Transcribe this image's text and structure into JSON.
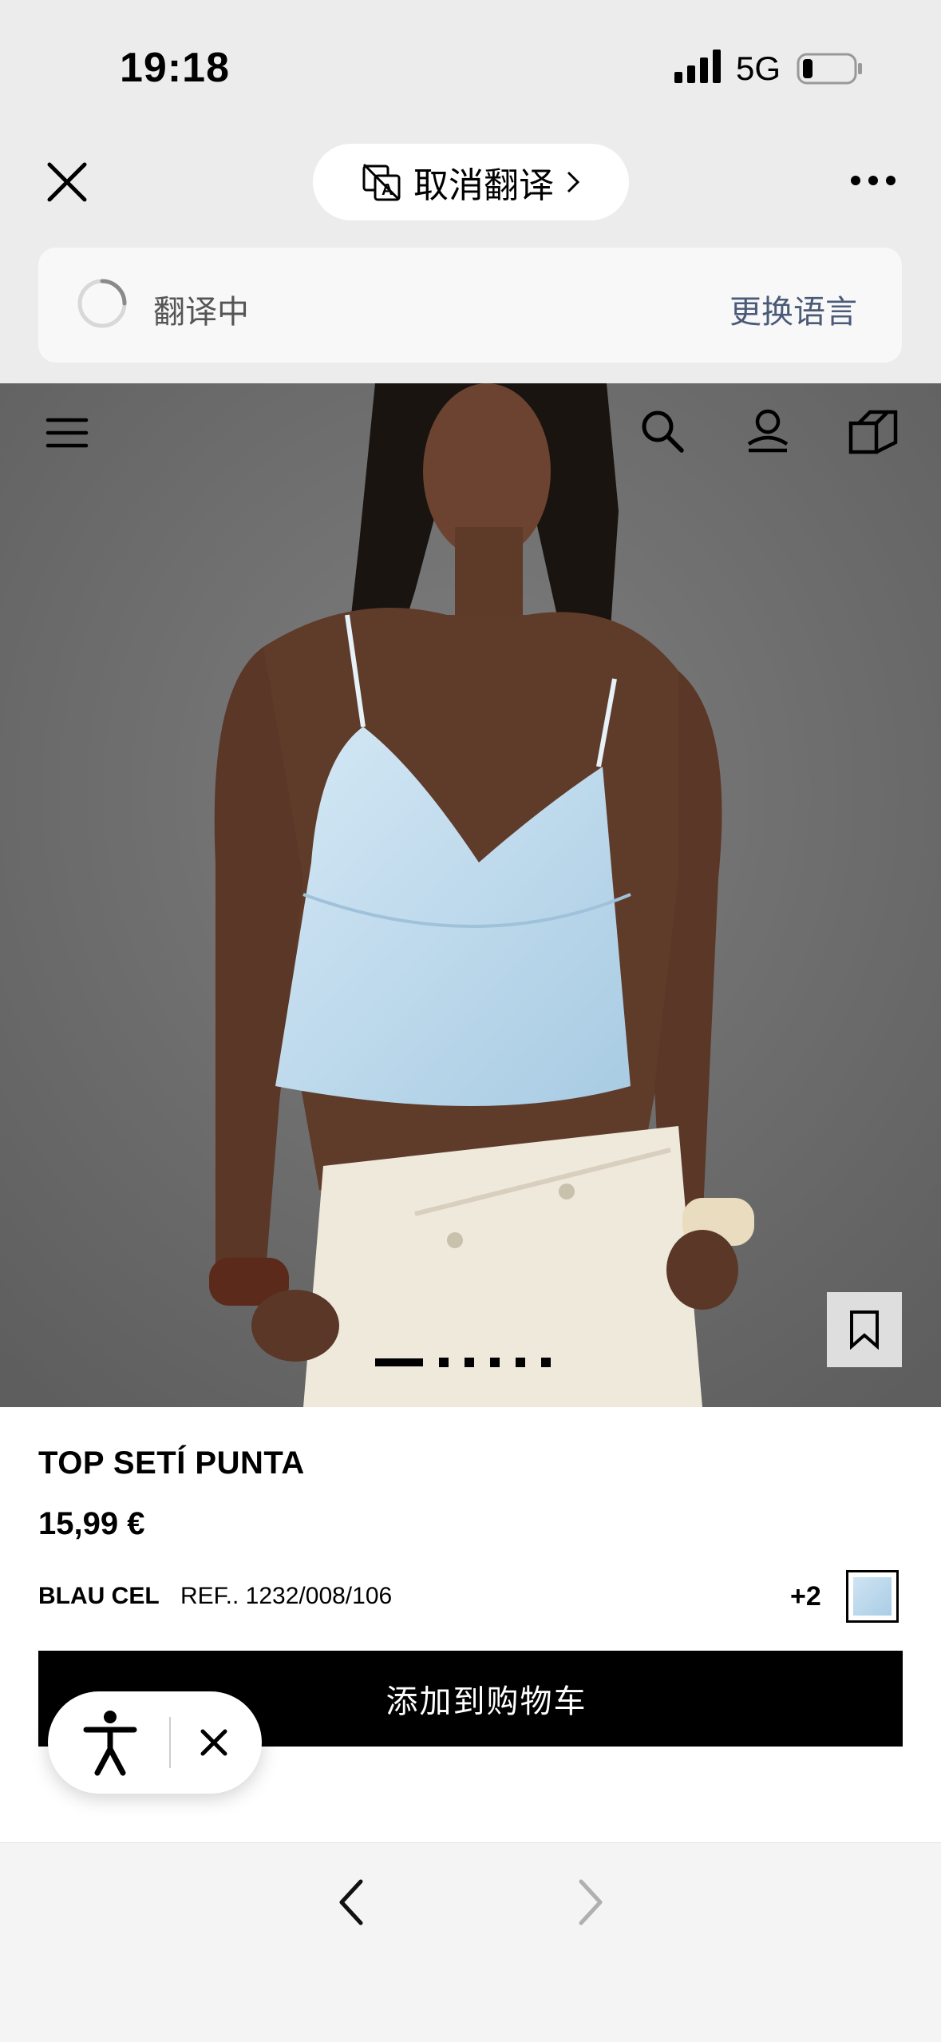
{
  "status_bar": {
    "time": "19:18",
    "network": "5G"
  },
  "browser": {
    "cancel_translation_label": "取消翻译",
    "translating_label": "翻译中",
    "change_language_label": "更换语言"
  },
  "gallery": {
    "slide_count": 6,
    "active_slide": 1
  },
  "product": {
    "name": "TOP SETÍ PUNTA",
    "price": "15,99 €",
    "color": "BLAU CEL",
    "reference": "REF.. 1232/008/106",
    "extra_colors": "+2",
    "add_to_cart_label": "添加到购物车"
  },
  "colors": {
    "accent": "#000000",
    "top_color": "#bcd9ec",
    "link_blue": "#4a5a78"
  }
}
